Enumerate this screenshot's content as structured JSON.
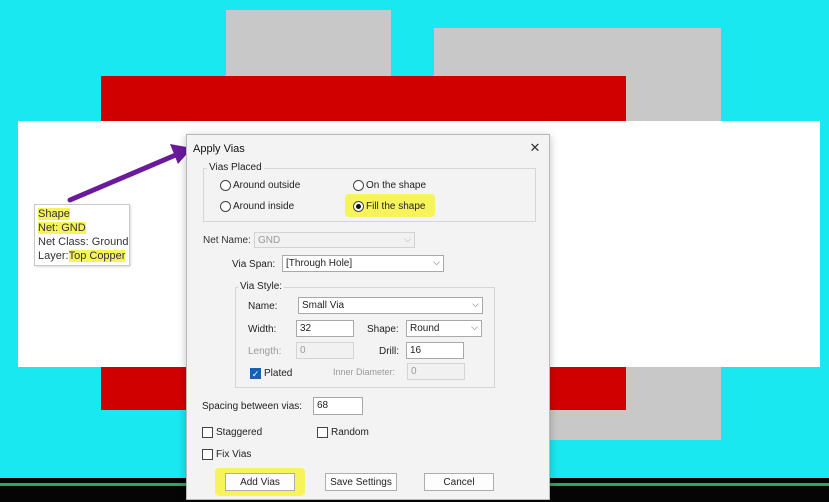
{
  "tooltip": {
    "line1": "Shape",
    "line2": "Net: GND",
    "line3": "Net Class: Ground",
    "line4_prefix": "Layer:",
    "line4_value": "Top Copper"
  },
  "dialog": {
    "title": "Apply Vias",
    "close_icon": "close-icon",
    "vias_placed": {
      "legend": "Vias Placed",
      "around_outside": "Around outside",
      "around_inside": "Around inside",
      "on_the_shape": "On the shape",
      "fill_the_shape": "Fill the shape",
      "selected": "Fill the shape"
    },
    "net_name": {
      "label": "Net Name:",
      "value": "GND"
    },
    "via_span": {
      "label": "Via Span:",
      "value": "[Through Hole]"
    },
    "via_style": {
      "legend": "Via Style:",
      "name_label": "Name:",
      "name_value": "Small Via",
      "width_label": "Width:",
      "width_value": "32",
      "shape_label": "Shape:",
      "shape_value": "Round",
      "length_label": "Length:",
      "length_value": "0",
      "drill_label": "Drill:",
      "drill_value": "16",
      "plated_label": "Plated",
      "plated_checked": true,
      "inner_diameter_label": "Inner Diameter:",
      "inner_diameter_value": "0"
    },
    "spacing": {
      "label": "Spacing between vias:",
      "value": "68"
    },
    "staggered": {
      "label": "Staggered",
      "checked": false
    },
    "random": {
      "label": "Random",
      "checked": false
    },
    "fix_vias": {
      "label": "Fix Vias",
      "checked": false
    },
    "buttons": {
      "add_vias": "Add Vias",
      "save_settings": "Save Settings",
      "cancel": "Cancel"
    }
  },
  "colors": {
    "canvas": "#1ae8f0",
    "copper_red": "#d10000",
    "shape_grey": "#c8c8c8",
    "highlight": "#f7f35a",
    "arrow": "#6a1a9a"
  }
}
